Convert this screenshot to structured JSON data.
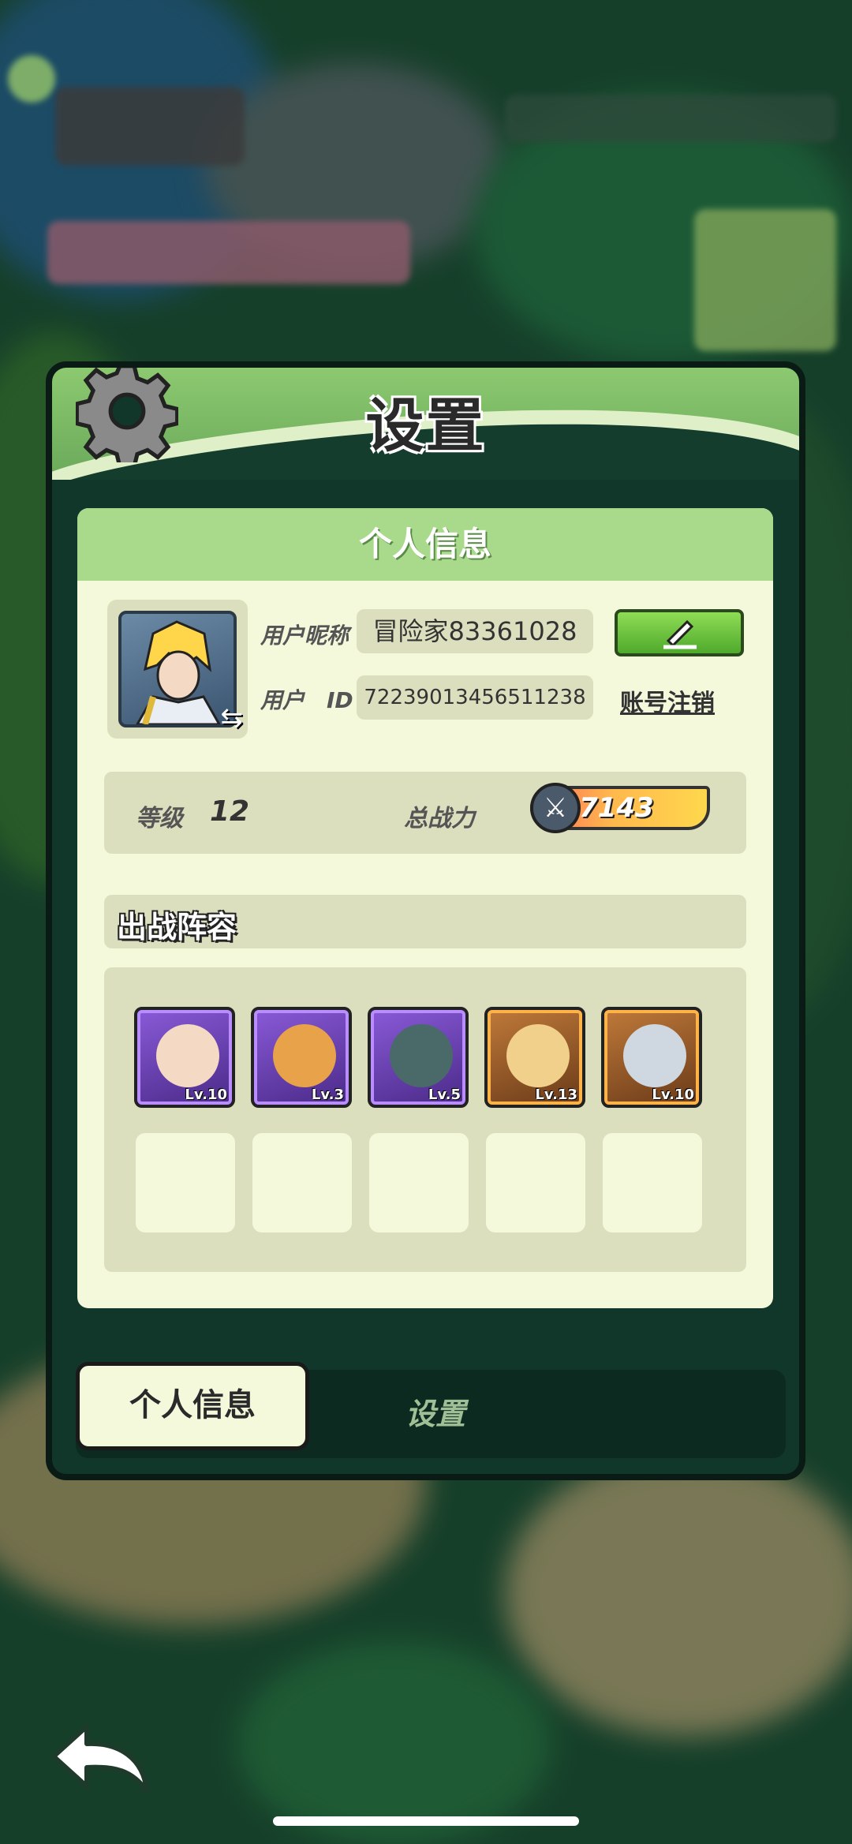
{
  "dialog": {
    "title": "设置"
  },
  "personal_info": {
    "header": "个人信息",
    "nickname_label": "用户昵称",
    "nickname_value": "冒险家83361028",
    "id_label": "用户　ID",
    "id_value": "72239013456511238",
    "cancel_account_label": "账号注销",
    "level_label": "等级",
    "level_value": "12",
    "power_label": "总战力",
    "power_value": "7143"
  },
  "lineup": {
    "title": "出战阵容",
    "heroes": [
      {
        "level": "Lv.10",
        "frame": "purple"
      },
      {
        "level": "Lv.3",
        "frame": "purple"
      },
      {
        "level": "Lv.5",
        "frame": "purple"
      },
      {
        "level": "Lv.13",
        "frame": "orange"
      },
      {
        "level": "Lv.10",
        "frame": "orange"
      }
    ]
  },
  "tabs": {
    "personal": "个人信息",
    "settings": "设置"
  },
  "colors": {
    "header_green": "#8cc970",
    "panel_bg": "#f4f9dc",
    "panel_header": "#a9d98a",
    "edit_green": "#5cc13a"
  }
}
